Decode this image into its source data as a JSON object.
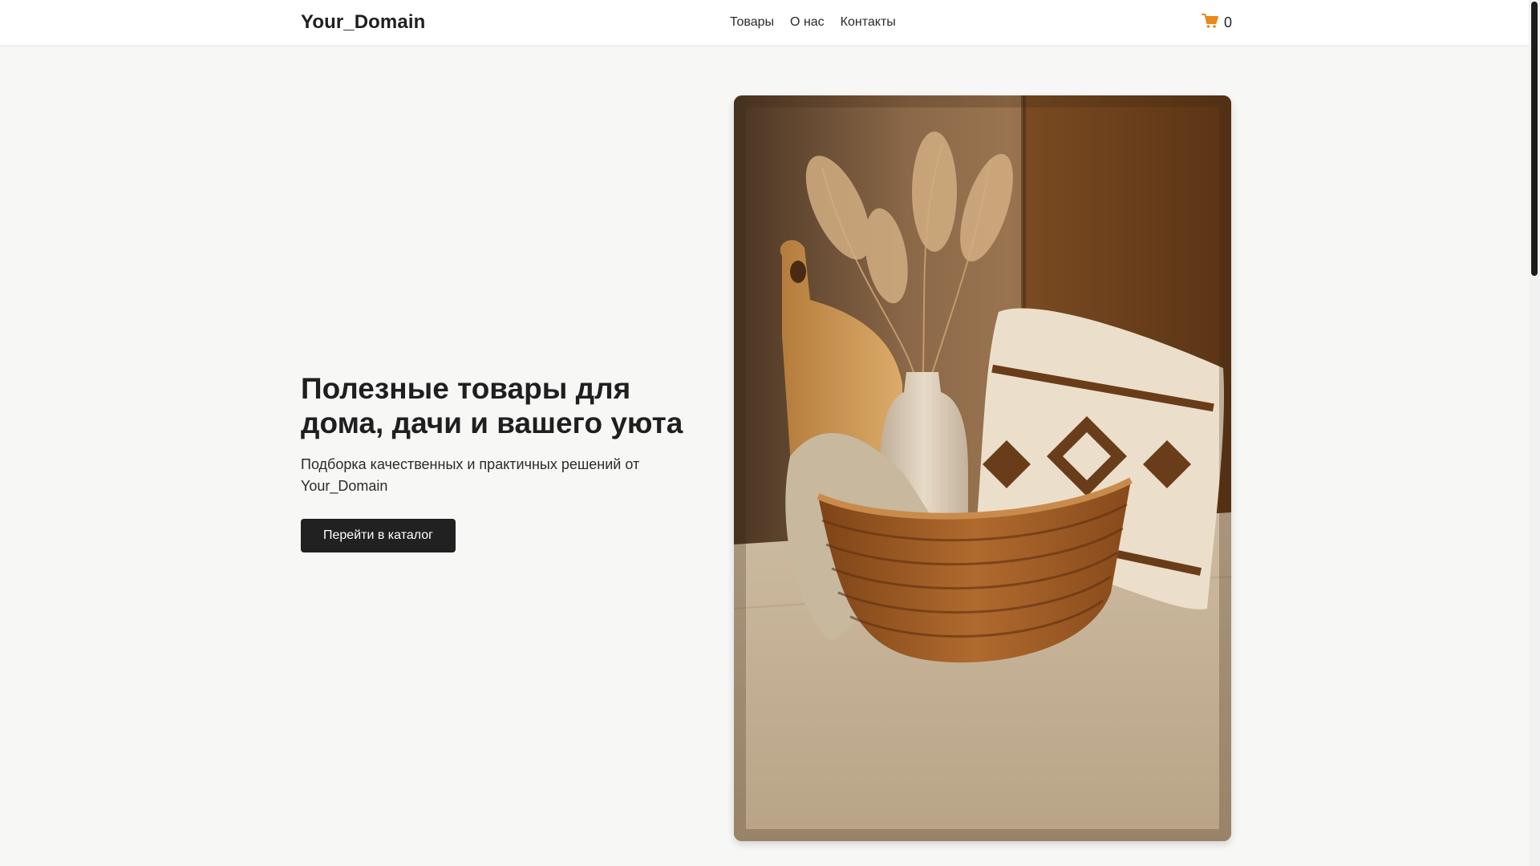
{
  "header": {
    "brand": "Your_Domain",
    "nav": [
      {
        "label": "Товары"
      },
      {
        "label": "О нас"
      },
      {
        "label": "Контакты"
      }
    ],
    "cart": {
      "icon": "shopping-cart-icon",
      "count": "0",
      "icon_color": "#e8891c"
    }
  },
  "hero": {
    "title": "Полезные товары для дома, дачи и вашего уюта",
    "subtitle": "Подборка качественных и практичных решений от Your_Domain",
    "cta_label": "Перейти в каталог",
    "image": "product-photo"
  },
  "colors": {
    "background": "#f7f7f6",
    "text": "#1f1f1f",
    "button": "#212121"
  }
}
